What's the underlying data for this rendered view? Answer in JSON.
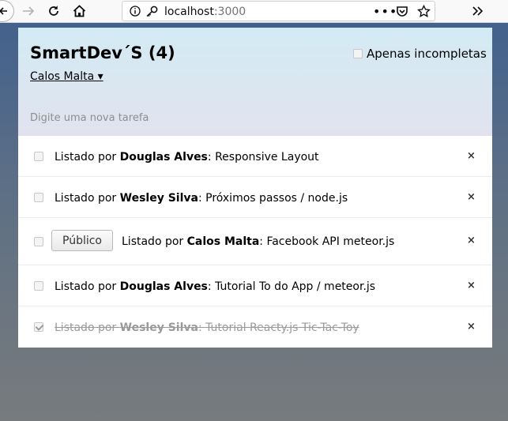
{
  "browser": {
    "url_host": "localhost",
    "url_port": ":3000",
    "icons": [
      "back-icon",
      "forward-icon",
      "reload-icon",
      "home-icon",
      "info-icon",
      "key-icon",
      "more-icon",
      "pocket-icon",
      "bookmark-star-icon",
      "overflow-icon"
    ]
  },
  "app": {
    "title": "SmartDev´S (4)",
    "hide_completed_label": "Apenas incompletas",
    "login_user": "Calos Malta ▾",
    "new_task_placeholder": "Digite uma nova tarefa",
    "tasks": [
      {
        "prefix": "Listado por ",
        "owner": "Douglas Alves",
        "text": ": Responsive Layout",
        "checked": false
      },
      {
        "prefix": "Listado por ",
        "owner": "Wesley Silva",
        "text": ": Próximos passos / node.js",
        "checked": false
      },
      {
        "prefix": "Listado por ",
        "owner": "Calos Malta",
        "text": ": Facebook API meteor.js",
        "checked": false,
        "privacy_button": "Público"
      },
      {
        "prefix": "Listado por ",
        "owner": "Douglas Alves",
        "text": ": Tutorial To do App / meteor.js",
        "checked": false
      },
      {
        "prefix": "Listado por ",
        "owner": "Wesley Silva",
        "text": ": Tutorial Reacty.js Tic-Tac-Toy",
        "checked": true
      }
    ],
    "delete_symbol": "×"
  }
}
